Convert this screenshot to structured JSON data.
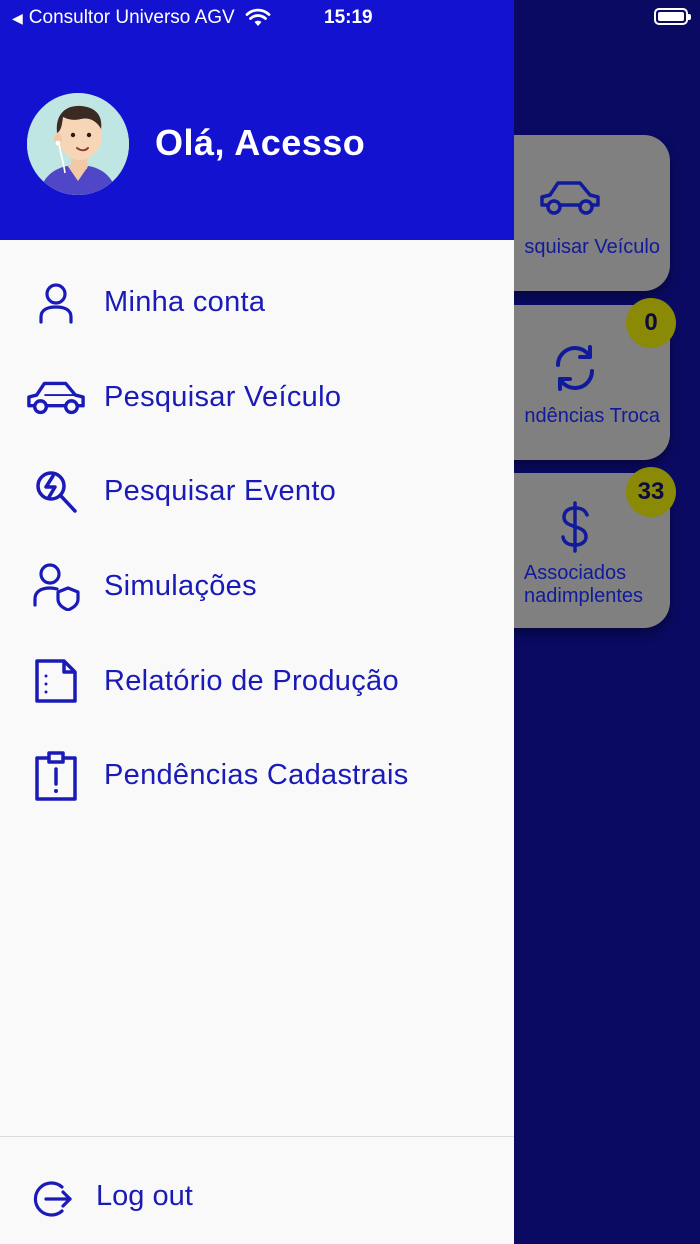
{
  "status_bar": {
    "back_arrow": "◀",
    "carrier": "Consultor Universo AGV",
    "time": "15:19"
  },
  "drawer": {
    "greeting": "Olá, Acesso",
    "menu": [
      {
        "label": "Minha conta",
        "icon": "user-icon"
      },
      {
        "label": "Pesquisar Veículo",
        "icon": "car-icon"
      },
      {
        "label": "Pesquisar Evento",
        "icon": "search-event-icon"
      },
      {
        "label": "Simulações",
        "icon": "user-shield-icon"
      },
      {
        "label": "Relatório de Produção",
        "icon": "report-icon"
      },
      {
        "label": "Pendências Cadastrais",
        "icon": "clipboard-alert-icon"
      }
    ],
    "logout_label": "Log out"
  },
  "background": {
    "cards": [
      {
        "label": "squisar Veículo",
        "icon": "car-icon"
      },
      {
        "label": "ndências Troca",
        "icon": "sync-icon",
        "badge": "0"
      },
      {
        "label_line1": "Associados",
        "label_line2": "nadimplentes",
        "icon": "dollar-icon",
        "badge": "33"
      }
    ]
  },
  "colors": {
    "header_blue": "#1212d0",
    "accent_blue": "#1a1ab8",
    "background_navy": "#0a0a63",
    "badge": "#8b8a06"
  }
}
